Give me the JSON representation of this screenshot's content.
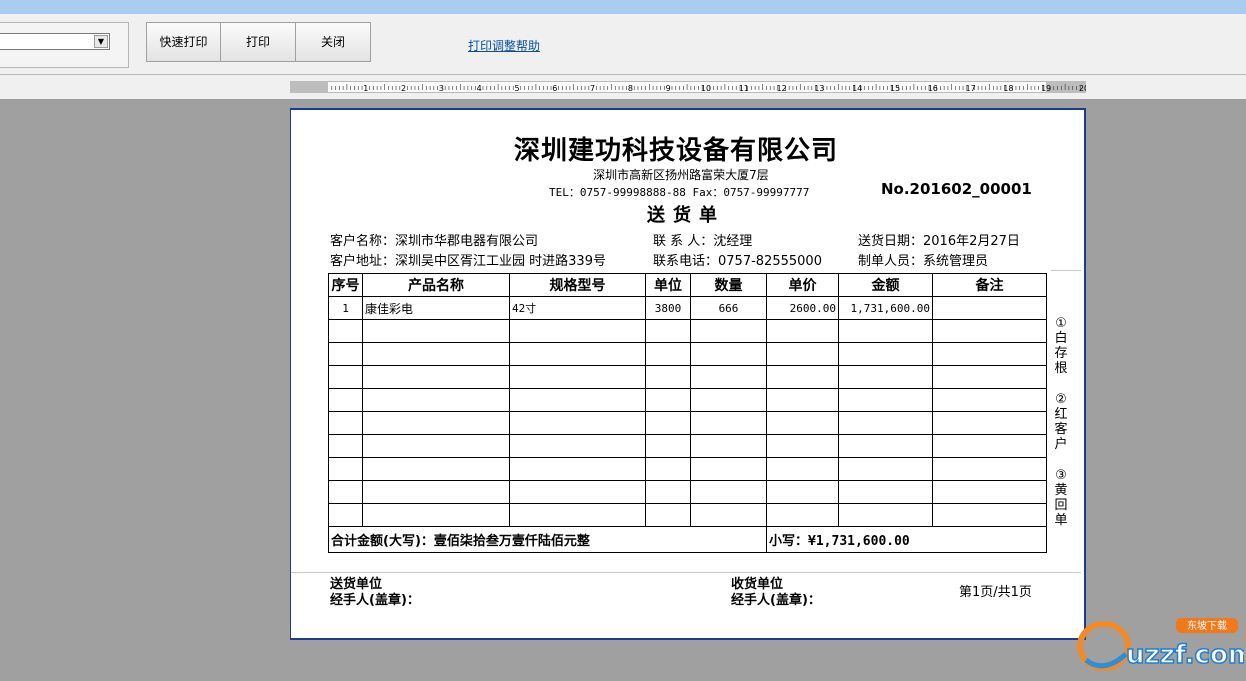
{
  "toolbar": {
    "quick_print_label": "快速打印",
    "print_label": "打印",
    "close_label": "关闭",
    "help_link": "打印调整帮助",
    "combo_value": ""
  },
  "ruler": {
    "labels": [
      "1",
      "2",
      "3",
      "4",
      "5",
      "6",
      "7",
      "8",
      "9",
      "10",
      "11",
      "12",
      "13",
      "14",
      "15",
      "16",
      "17",
      "18",
      "19",
      "20"
    ]
  },
  "document": {
    "company_name": "深圳建功科技设备有限公司",
    "address": "深圳市高新区扬州路富荣大厦7层",
    "contact": "TEL：0757-99998888-88 Fax：0757-99997777",
    "doc_number": "No.201602_00001",
    "doc_title": "送货单",
    "customer_name_label": "客户名称：",
    "customer_name": "深圳市华郡电器有限公司",
    "contact_person_label": "联 系 人：",
    "contact_person": "沈经理",
    "delivery_date_label": "送货日期：",
    "delivery_date": "2016年2月27日",
    "customer_address_label": "客户地址：",
    "customer_address": "深圳吴中区胥江工业园 时进路339号",
    "phone_label": "联系电话：",
    "phone": "0757-82555000",
    "creator_label": "制单人员：",
    "creator": "系统管理员"
  },
  "table": {
    "columns": [
      "序号",
      "产品名称",
      "规格型号",
      "单位",
      "数量",
      "单价",
      "金额",
      "备注"
    ],
    "rows": [
      [
        "1",
        "康佳彩电",
        "42寸",
        "3800",
        "666",
        "2600.00",
        "1,731,600.00",
        ""
      ]
    ],
    "empty_rows": 9,
    "total_cn_label": "合计金额(大写)：",
    "total_cn": "壹佰柒拾叁万壹仟陆佰元整",
    "total_small_label": "小写：",
    "total_small": "¥1,731,600.00"
  },
  "copies": [
    "①白存根",
    "②红客户",
    "③黄回单"
  ],
  "footer": {
    "sender_unit": "送货单位",
    "sender_handler": "经手人(盖章)：",
    "receiver_unit": "收货单位",
    "receiver_handler": "经手人(盖章)：",
    "page_info": "第1页/共1页"
  },
  "watermark": {
    "logo_text": "uzzf.com",
    "badge_text": "东坡下载"
  }
}
